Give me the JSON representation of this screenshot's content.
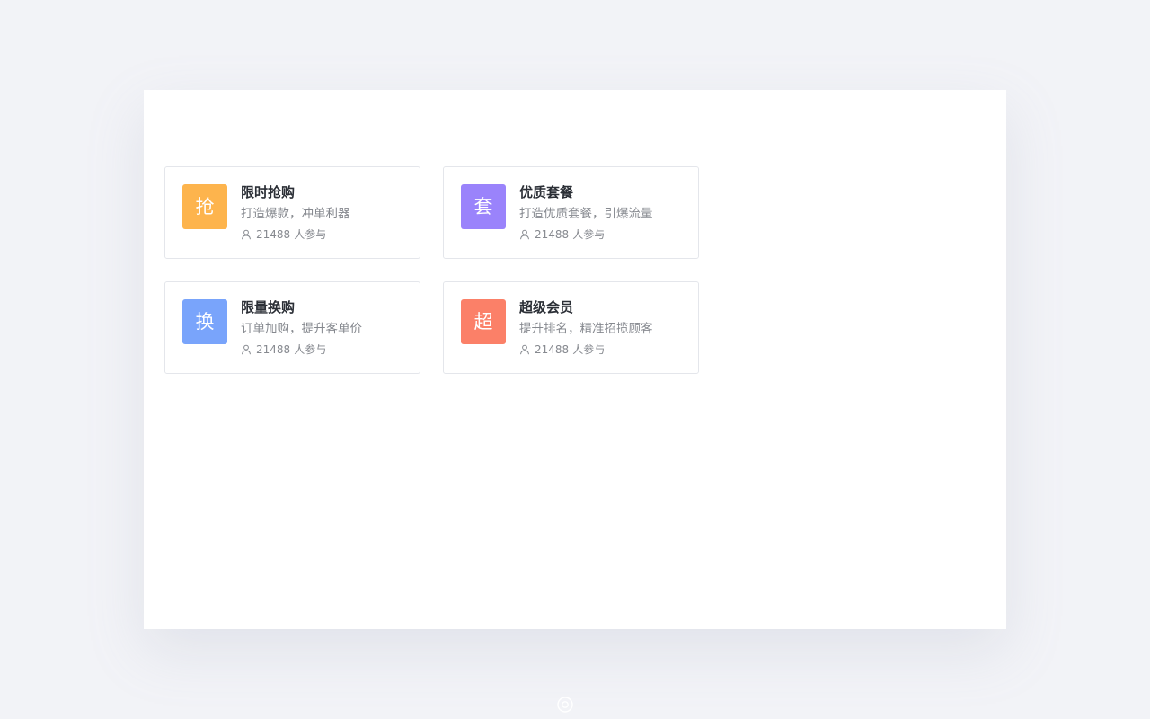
{
  "cards": [
    {
      "badge": "抢",
      "color": "#fdb44d",
      "title": "限时抢购",
      "desc": "打造爆款，冲单利器",
      "count": "21488",
      "count_suffix": "人参与",
      "icon": "user-icon"
    },
    {
      "badge": "套",
      "color": "#9a83fb",
      "title": "优质套餐",
      "desc": "打造优质套餐，引爆流量",
      "count": "21488",
      "count_suffix": "人参与",
      "icon": "user-icon"
    },
    {
      "badge": "换",
      "color": "#79a4fb",
      "title": "限量换购",
      "desc": "订单加购，提升客单价",
      "count": "21488",
      "count_suffix": "人参与",
      "icon": "user-icon"
    },
    {
      "badge": "超",
      "color": "#fb8068",
      "title": "超级会员",
      "desc": "提升排名，精准招揽顾客",
      "count": "21488",
      "count_suffix": "人参与",
      "icon": "user-icon"
    }
  ],
  "colors": {
    "background": "#f2f3f7",
    "panel": "#ffffff",
    "card_border": "#e4e6eb",
    "title_text": "#2b2f36",
    "muted_text": "#86898f"
  },
  "footer": {
    "icon": "circle-logo-icon"
  }
}
